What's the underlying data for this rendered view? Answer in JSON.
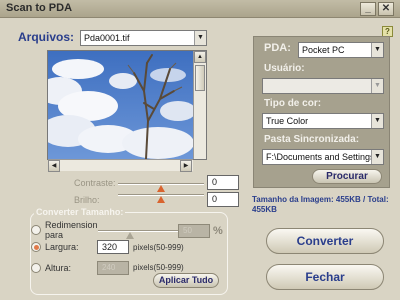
{
  "window": {
    "title": "Scan to PDA",
    "minimize_glyph": "_",
    "close_glyph": "✕"
  },
  "files": {
    "label": "Arquivos:",
    "selected": "Pda0001.tif"
  },
  "adjust": {
    "contrast_label": "Contraste:",
    "contrast_value": "0",
    "brightness_label": "Brilho:",
    "brightness_value": "0"
  },
  "resize": {
    "group_title": "Converter Tamanho:",
    "option_resize_label": "Redimension para",
    "percent_value": "50",
    "percent_symbol": "%",
    "width_label": "Largura:",
    "width_value": "320",
    "width_units": "pixels(50-999)",
    "height_label": "Altura:",
    "height_value": "240",
    "height_units": "pixels(50-999)",
    "apply_all_label": "Aplicar Tudo",
    "selected_option": "width"
  },
  "pda": {
    "label": "PDA:",
    "selected": "Pocket PC",
    "user_label": "Usuário:",
    "user_value": "",
    "color_label": "Tipo de cor:",
    "color_value": "True Color",
    "sync_label": "Pasta Sincronizada:",
    "sync_value": "F:\\Documents and Settings",
    "browse_label": "Procurar"
  },
  "info": {
    "size_text": "Tamanho da Imagem: 455KB / Total: 455KB"
  },
  "actions": {
    "convert_label": "Converter",
    "close_label": "Fechar"
  },
  "icons": {
    "help": "?",
    "dropdown": "▼",
    "scroll_up": "▲",
    "scroll_left": "◀",
    "scroll_right": "▶"
  }
}
